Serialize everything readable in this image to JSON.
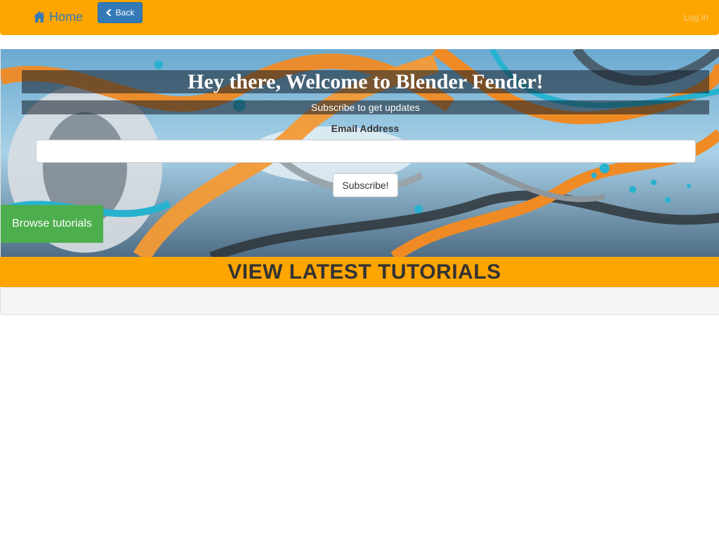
{
  "navbar": {
    "home_label": "Home",
    "home_icon": "home-icon",
    "back_label": "Back",
    "back_icon": "chevron-left-icon",
    "login_label": "Log in"
  },
  "hero": {
    "title": "Hey there, Welcome to Blender Fender!",
    "subtitle": "Subscribe to get updates",
    "email_label": "Email Address",
    "email_value": "",
    "email_placeholder": "",
    "subscribe_label": "Subscribe!",
    "browse_label": "Browse tutorials"
  },
  "latest": {
    "title": "VIEW LATEST TUTORIALS"
  },
  "colors": {
    "brand_orange": "#ffa500",
    "primary_blue": "#337ab7",
    "success_green": "#4cae4c"
  }
}
